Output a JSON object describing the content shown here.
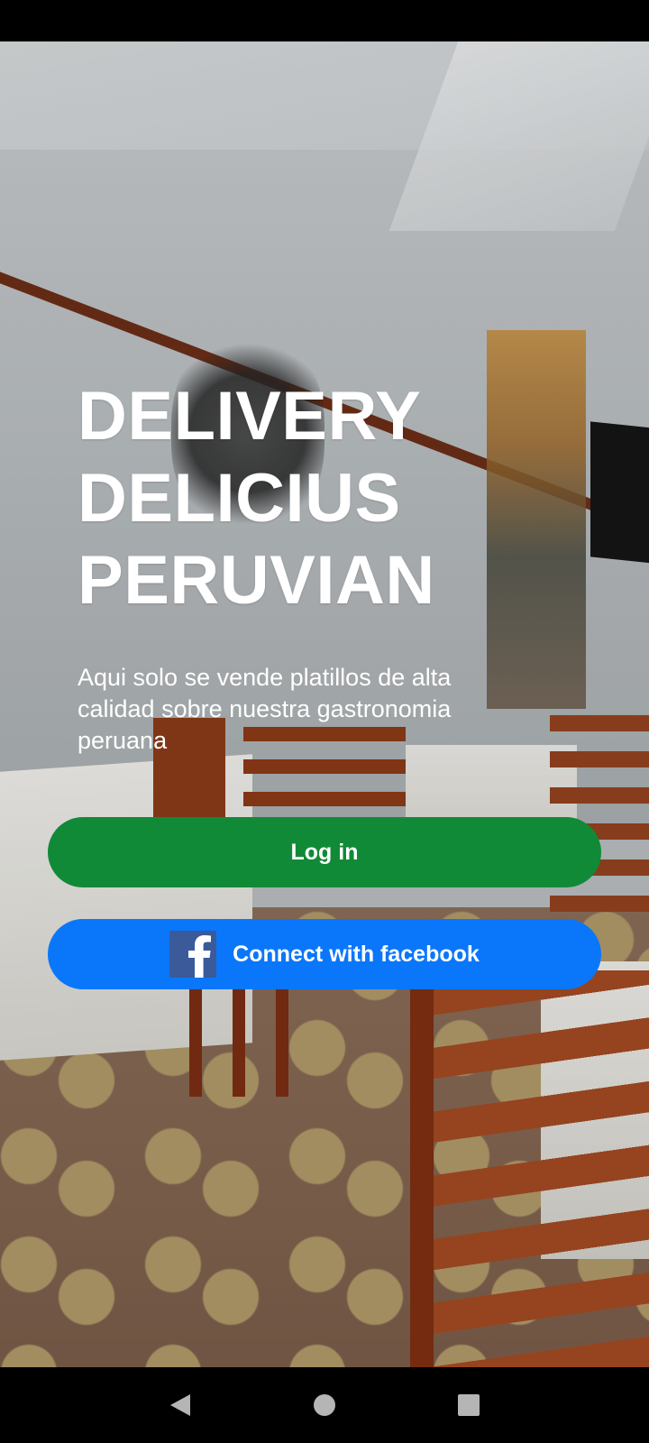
{
  "headline": {
    "line1": "DELIVERY",
    "line2": "DELICIUS",
    "line3": "PERUVIAN"
  },
  "subtitle": "Aqui solo se vende platillos de alta calidad sobre nuestra gastronomia peruana",
  "buttons": {
    "login_label": "Log in",
    "facebook_label": "Connect with facebook"
  },
  "icons": {
    "facebook": "facebook-logo-icon",
    "back": "back-triangle-icon",
    "home": "home-circle-icon",
    "recents": "recents-square-icon"
  },
  "colors": {
    "login_button": "#118a37",
    "facebook_button": "#0a77fa",
    "facebook_logo_bg": "#3b5a99",
    "text": "#ffffff"
  }
}
